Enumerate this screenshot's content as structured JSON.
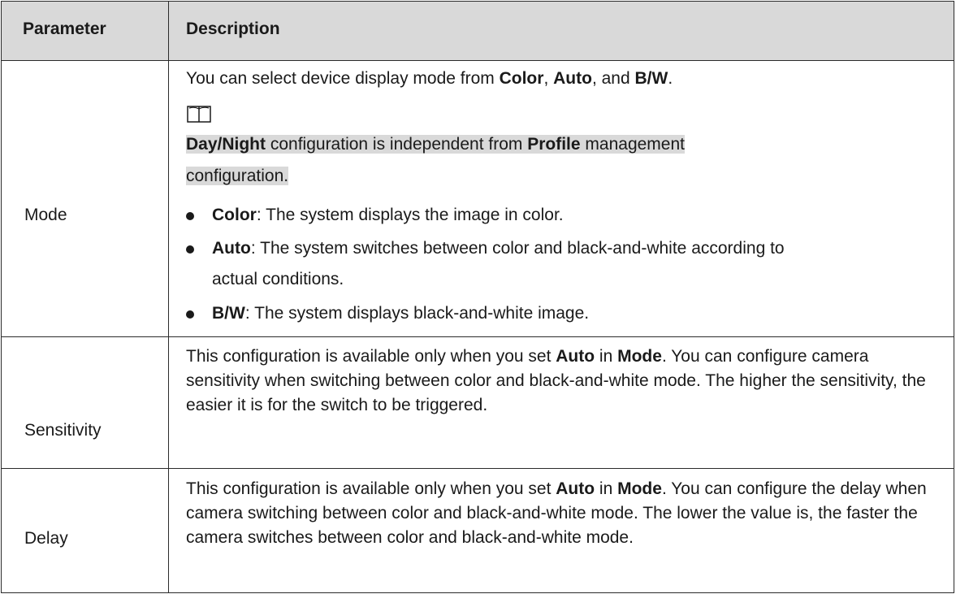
{
  "header": {
    "parameter": "Parameter",
    "description": "Description"
  },
  "rows": {
    "mode": {
      "param": "Mode",
      "intro": {
        "t1": "You can select device display mode from ",
        "b1": "Color",
        "t2": ", ",
        "b2": "Auto",
        "t3": ", and ",
        "b3": "B/W",
        "t4": "."
      },
      "note": {
        "b1": "Day/Night",
        "t1": " configuration is independent from ",
        "b2": "Profile",
        "t2": " management",
        "line2": "configuration."
      },
      "bullets": [
        {
          "bold": "Color",
          "text": ": The system displays the image in color."
        },
        {
          "bold": "Auto",
          "text": ": The system switches between color and black-and-white according to",
          "cont": "actual conditions."
        },
        {
          "bold": "B/W",
          "text": ": The system displays black-and-white image."
        }
      ]
    },
    "sensitivity": {
      "param": "Sensitivity",
      "t1": "This configuration is available only when you set ",
      "b1": "Auto",
      "t2": " in ",
      "b2": "Mode",
      "t3": ". You can configure camera sensitivity when switching between color and black-and-white mode. The higher the sensitivity, the easier it is for the switch to be triggered."
    },
    "delay": {
      "param": "Delay",
      "t1": "This configuration is available only when you set ",
      "b1": "Auto",
      "t2": " in ",
      "b2": "Mode",
      "t3": ". You can configure the delay when camera switching between color and black-and-white mode. The lower the value is, the faster the camera switches between color and black-and-white mode."
    }
  },
  "colors": {
    "header_bg": "#d9d9d9",
    "border": "#2b2b2b"
  },
  "icons": {
    "note": "note-book-icon",
    "bullet": "bullet-dot-icon"
  }
}
